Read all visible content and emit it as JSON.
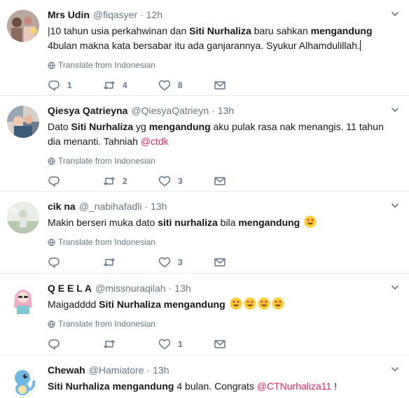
{
  "tweets": [
    {
      "fullname": "Mrs Udin",
      "username": "@fiqasyer",
      "dot": "·",
      "time": "12h",
      "text": [
        {
          "t": "|10 tahun usia perkahwinan dan ",
          "b": false
        },
        {
          "t": "Siti Nurhaliza",
          "b": true
        },
        {
          "t": " baru sahkan ",
          "b": false
        },
        {
          "t": "mengandung",
          "b": true
        },
        {
          "t": " 4bulan makna kata bersabar itu ada ganjarannya. Syukur Alhamdulillah.",
          "b": false
        }
      ],
      "translate_label": "Translate from Indonesian",
      "reply_count": "1",
      "retweet_count": "4",
      "like_count": "8"
    },
    {
      "fullname": "Qiesya Qatrieyna",
      "username": "@QiesyaQatrieyn",
      "dot": "·",
      "time": "13h",
      "text": [
        {
          "t": "Dato ",
          "b": false
        },
        {
          "t": "Siti Nurhaliza",
          "b": true
        },
        {
          "t": " yg ",
          "b": false
        },
        {
          "t": "mengandung",
          "b": true
        },
        {
          "t": " aku pulak rasa nak menangis. 11 tahun dia menanti. Tahniah ",
          "b": false
        },
        {
          "t": "@ctdk",
          "link": true
        }
      ],
      "translate_label": "Translate from Indonesian",
      "reply_count": "",
      "retweet_count": "2",
      "like_count": "3"
    },
    {
      "fullname": "cik na",
      "username": "@_nabihafadli",
      "dot": "·",
      "time": "13h",
      "text": [
        {
          "t": "Makin berseri muka dato ",
          "b": false
        },
        {
          "t": "siti nurhaliza",
          "b": true
        },
        {
          "t": " bila ",
          "b": false
        },
        {
          "t": "mengandung",
          "b": true
        }
      ],
      "emoji_count": 1,
      "translate_label": "Translate from Indonesian",
      "reply_count": "",
      "retweet_count": "",
      "like_count": "3"
    },
    {
      "fullname": "Q E E L A",
      "username": "@missnuraqilah",
      "dot": "·",
      "time": "13h",
      "text": [
        {
          "t": "Maigadddd ",
          "b": false
        },
        {
          "t": "Siti Nurhaliza mengandung",
          "b": true
        }
      ],
      "emoji_count": 4,
      "translate_label": "Translate from Indonesian",
      "reply_count": "",
      "retweet_count": "",
      "like_count": "1"
    },
    {
      "fullname": "Chewah",
      "username": "@Hamiatore",
      "dot": "·",
      "time": "13h",
      "text": [
        {
          "t": "Siti Nurhaliza mengandung",
          "b": true
        },
        {
          "t": " 4 bulan. Congrats ",
          "b": false
        },
        {
          "t": "@CTNurhaliza11",
          "link": true
        },
        {
          "t": " !",
          "b": false
        }
      ]
    }
  ],
  "colors": {
    "text": "#14171a",
    "muted": "#657786",
    "link": "#e0245e",
    "border": "#e6ecf0"
  }
}
